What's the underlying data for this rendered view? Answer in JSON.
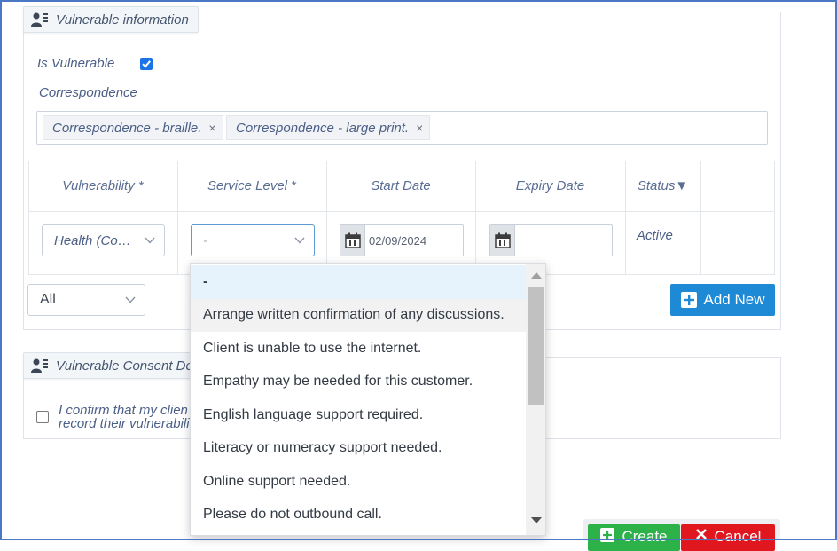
{
  "vulnerable_panel": {
    "title": "Vulnerable information",
    "is_vulnerable_label": "Is Vulnerable",
    "is_vulnerable_checked": true,
    "correspondence_label": "Correspondence",
    "correspondence_tags": [
      {
        "label": "Correspondence - braille.",
        "remove": "×"
      },
      {
        "label": "Correspondence - large print.",
        "remove": "×"
      }
    ]
  },
  "grid": {
    "columns": [
      "Vulnerability *",
      "Service Level *",
      "Start Date",
      "Expiry Date",
      "Status▼"
    ],
    "row": {
      "vulnerability": "Health (Co…",
      "service_level": "-",
      "start_date": "02/09/2024",
      "expiry_date": "",
      "status": "Active"
    },
    "filter_value": "All",
    "add_new_label": "Add New"
  },
  "consent_panel": {
    "title": "Vulnerable Consent De",
    "confirm_text_line1": "I confirm that my clien",
    "confirm_text_line2": "record their vulnerabili",
    "confirm_checked": false
  },
  "service_level_dropdown": {
    "options": [
      "-",
      "Arrange written confirmation of any discussions.",
      "Client is unable to use the internet.",
      "Empathy may be needed for this customer.",
      "English language support required.",
      "Literacy or numeracy support needed.",
      "Online support needed.",
      "Please do not outbound call."
    ],
    "selected_index": 0,
    "hover_index": 1
  },
  "footer": {
    "create_label": "Create",
    "cancel_label": "Cancel"
  },
  "colors": {
    "accent_blue": "#1e8ad6",
    "create_green": "#2db24a",
    "cancel_red": "#e0171f",
    "checkbox_blue": "#1a73e8"
  }
}
